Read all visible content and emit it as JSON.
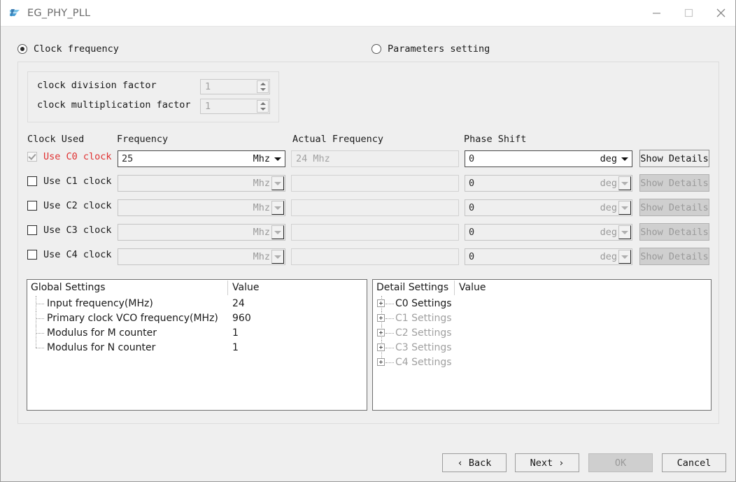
{
  "window": {
    "title": "EG_PHY_PLL",
    "icon": "app-logo-icon",
    "minimize": "—",
    "maximize": "□",
    "close": "✕"
  },
  "mode": {
    "options": [
      {
        "label": "Clock frequency",
        "selected": true
      },
      {
        "label": "Parameters setting",
        "selected": false
      }
    ]
  },
  "factors": {
    "rows": [
      {
        "label": "clock division factor",
        "value": "1",
        "enabled": false
      },
      {
        "label": "clock multiplication factor",
        "value": "1",
        "enabled": false
      }
    ]
  },
  "clock_table": {
    "headers": {
      "clock_used": "Clock Used",
      "frequency": "Frequency",
      "actual_frequency": "Actual Frequency",
      "phase_shift": "Phase Shift"
    },
    "rows": [
      {
        "checkbox_label": "Use C0 clock",
        "checked": true,
        "checkbox_enabled": false,
        "label_highlight": true,
        "frequency": "25",
        "frequency_unit": "Mhz",
        "actual_frequency": "24 Mhz",
        "phase_shift": "0",
        "phase_unit": "deg",
        "details_label": "Show Details",
        "enabled": true
      },
      {
        "checkbox_label": "Use C1 clock",
        "checked": false,
        "checkbox_enabled": true,
        "label_highlight": false,
        "frequency": "",
        "frequency_unit": "Mhz",
        "actual_frequency": "",
        "phase_shift": "0",
        "phase_unit": "deg",
        "details_label": "Show Details",
        "enabled": false
      },
      {
        "checkbox_label": "Use C2 clock",
        "checked": false,
        "checkbox_enabled": true,
        "label_highlight": false,
        "frequency": "",
        "frequency_unit": "Mhz",
        "actual_frequency": "",
        "phase_shift": "0",
        "phase_unit": "deg",
        "details_label": "Show Details",
        "enabled": false
      },
      {
        "checkbox_label": "Use C3 clock",
        "checked": false,
        "checkbox_enabled": true,
        "label_highlight": false,
        "frequency": "",
        "frequency_unit": "Mhz",
        "actual_frequency": "",
        "phase_shift": "0",
        "phase_unit": "deg",
        "details_label": "Show Details",
        "enabled": false
      },
      {
        "checkbox_label": "Use C4 clock",
        "checked": false,
        "checkbox_enabled": true,
        "label_highlight": false,
        "frequency": "",
        "frequency_unit": "Mhz",
        "actual_frequency": "",
        "phase_shift": "0",
        "phase_unit": "deg",
        "details_label": "Show Details",
        "enabled": false
      }
    ]
  },
  "global_settings": {
    "col_name": "Global Settings",
    "col_value": "Value",
    "rows": [
      {
        "label": "Input frequency(MHz)",
        "value": "24"
      },
      {
        "label": "Primary clock VCO frequency(MHz)",
        "value": "960"
      },
      {
        "label": "Modulus for M counter",
        "value": "1"
      },
      {
        "label": "Modulus for N counter",
        "value": "1"
      }
    ]
  },
  "detail_settings": {
    "col_name": "Detail Settings",
    "col_value": "Value",
    "rows": [
      {
        "label": "C0 Settings",
        "value": "",
        "enabled": true
      },
      {
        "label": "C1 Settings",
        "value": "",
        "enabled": false
      },
      {
        "label": "C2 Settings",
        "value": "",
        "enabled": false
      },
      {
        "label": "C3 Settings",
        "value": "",
        "enabled": false
      },
      {
        "label": "C4 Settings",
        "value": "",
        "enabled": false
      }
    ]
  },
  "footer": {
    "back": "‹  Back",
    "next": "Next  ›",
    "ok": "OK",
    "cancel": "Cancel"
  },
  "colors": {
    "highlight_red": "#e03030",
    "disabled_text": "#a0a0a0",
    "window_bg": "#efefef"
  }
}
